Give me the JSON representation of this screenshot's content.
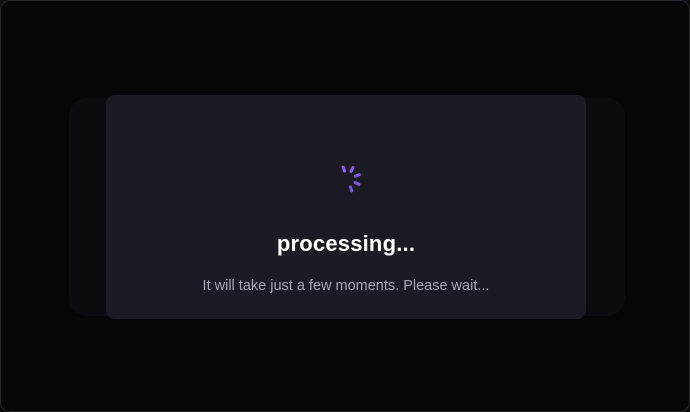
{
  "dialog": {
    "title": "processing...",
    "message": "It will take just a few moments. Please wait..."
  },
  "spinner": {
    "icon": "loading-spinner-icon",
    "color": "#8b5cf6"
  },
  "colors": {
    "background": "#060508",
    "card": "#1c1a23",
    "title": "#ffffff",
    "message": "#a9a6b3"
  }
}
